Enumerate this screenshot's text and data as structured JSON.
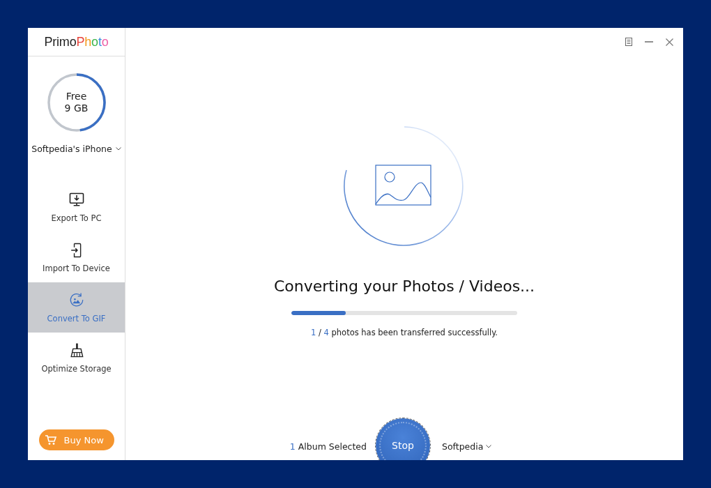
{
  "logo": {
    "parts": [
      {
        "text": "Primo",
        "color": "#222222"
      },
      {
        "text": "P",
        "color": "#e8453c"
      },
      {
        "text": "h",
        "color": "#f39a1e"
      },
      {
        "text": "o",
        "color": "#3bb54a"
      },
      {
        "text": "t",
        "color": "#3d8fe0"
      },
      {
        "text": "o",
        "color": "#ee5fa7"
      }
    ]
  },
  "storage": {
    "label": "Free",
    "amount": "9 GB",
    "level": 0.48
  },
  "device": {
    "name": "Softpedia's iPhone"
  },
  "nav": [
    {
      "kind": "export",
      "label": "Export To PC",
      "selected": false
    },
    {
      "kind": "import",
      "label": "Import To Device",
      "selected": false
    },
    {
      "kind": "gif",
      "label": "Convert To GIF",
      "selected": true
    },
    {
      "kind": "optimize",
      "label": "Optimize Storage",
      "selected": false
    }
  ],
  "buy_button": {
    "label": "Buy Now"
  },
  "status": {
    "title": "Converting your Photos / Videos...",
    "level": 0.24,
    "done": "1",
    "separator": "/",
    "total": "4",
    "message": "photos has been transferred successfully."
  },
  "footer": {
    "album_count": "1",
    "album_label": "Album Selected",
    "stop": "Stop",
    "destination": "Softpedia"
  }
}
